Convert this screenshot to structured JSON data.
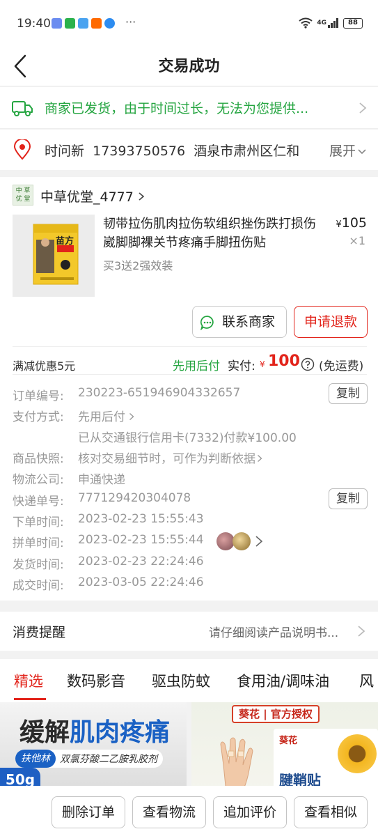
{
  "status_bar": {
    "time": "19:40",
    "dots": "···",
    "network": "4G",
    "battery": "88"
  },
  "nav": {
    "title": "交易成功"
  },
  "shipping": {
    "text": "商家已发货，由于时间过长，无法为您提供..."
  },
  "address": {
    "name": "时问新",
    "phone": "17393750576",
    "address": "酒泉市肃州区仁和",
    "expand": "展开"
  },
  "shop": {
    "logo_text": "中 草 优 堂",
    "name": "中草优堂_4777"
  },
  "product": {
    "title": "韧带拉伤肌肉拉伤软组织挫伤跌打损伤崴脚脚裸关节疼痛手脚扭伤贴",
    "spec": "买3送2强效装",
    "price_symbol": "¥",
    "price": "105",
    "qty": "×1",
    "image_text": "苗方"
  },
  "actions": {
    "contact": "联系商家",
    "refund": "申请退款"
  },
  "payment_summary": {
    "discount": "满减优惠5元",
    "pay_later": "先用后付",
    "paid_label": "实付:",
    "currency": "¥",
    "amount": "100",
    "freight": "(免运费)"
  },
  "order_info": {
    "order_no_label": "订单编号:",
    "order_no": "230223-651946904332657",
    "pay_method_label": "支付方式:",
    "pay_method": "先用后付",
    "pay_detail": "已从交通银行信用卡(7332)付款¥100.00",
    "snapshot_label": "商品快照:",
    "snapshot": "核对交易细节时，可作为判断依据",
    "logistics_label": "物流公司:",
    "logistics": "申通快递",
    "tracking_label": "快递单号:",
    "tracking": "777129420304078",
    "order_time_label": "下单时间:",
    "order_time": "2023-02-23 15:55:43",
    "group_time_label": "拼单时间:",
    "group_time": "2023-02-23 15:55:44",
    "ship_time_label": "发货时间:",
    "ship_time": "2023-02-23 22:24:46",
    "deal_time_label": "成交时间:",
    "deal_time": "2023-03-05 22:24:46",
    "copy_label": "复制"
  },
  "reminder": {
    "title": "消费提醒",
    "value": "请仔细阅读产品说明书..."
  },
  "tabs": [
    {
      "label": "精选"
    },
    {
      "label": "数码影音"
    },
    {
      "label": "驱虫防蚊"
    },
    {
      "label": "食用油/调味油"
    },
    {
      "label": "风"
    }
  ],
  "ads": {
    "ad1_title_a": "缓解",
    "ad1_title_b": "肌肉疼痛",
    "ad1_brand": "扶他林",
    "ad1_sub": "双氯芬酸二乙胺乳胶剂",
    "ad1_weight": "50g",
    "ad2_banner": "葵花 | 官方授权",
    "ad2_brand": "葵花",
    "ad2_name": "腱鞘贴"
  },
  "bottom_actions": {
    "delete": "删除订单",
    "logistics": "查看物流",
    "review": "追加评价",
    "similar": "查看相似"
  },
  "colors": {
    "accent_red": "#e2231a",
    "green": "#25a541"
  }
}
